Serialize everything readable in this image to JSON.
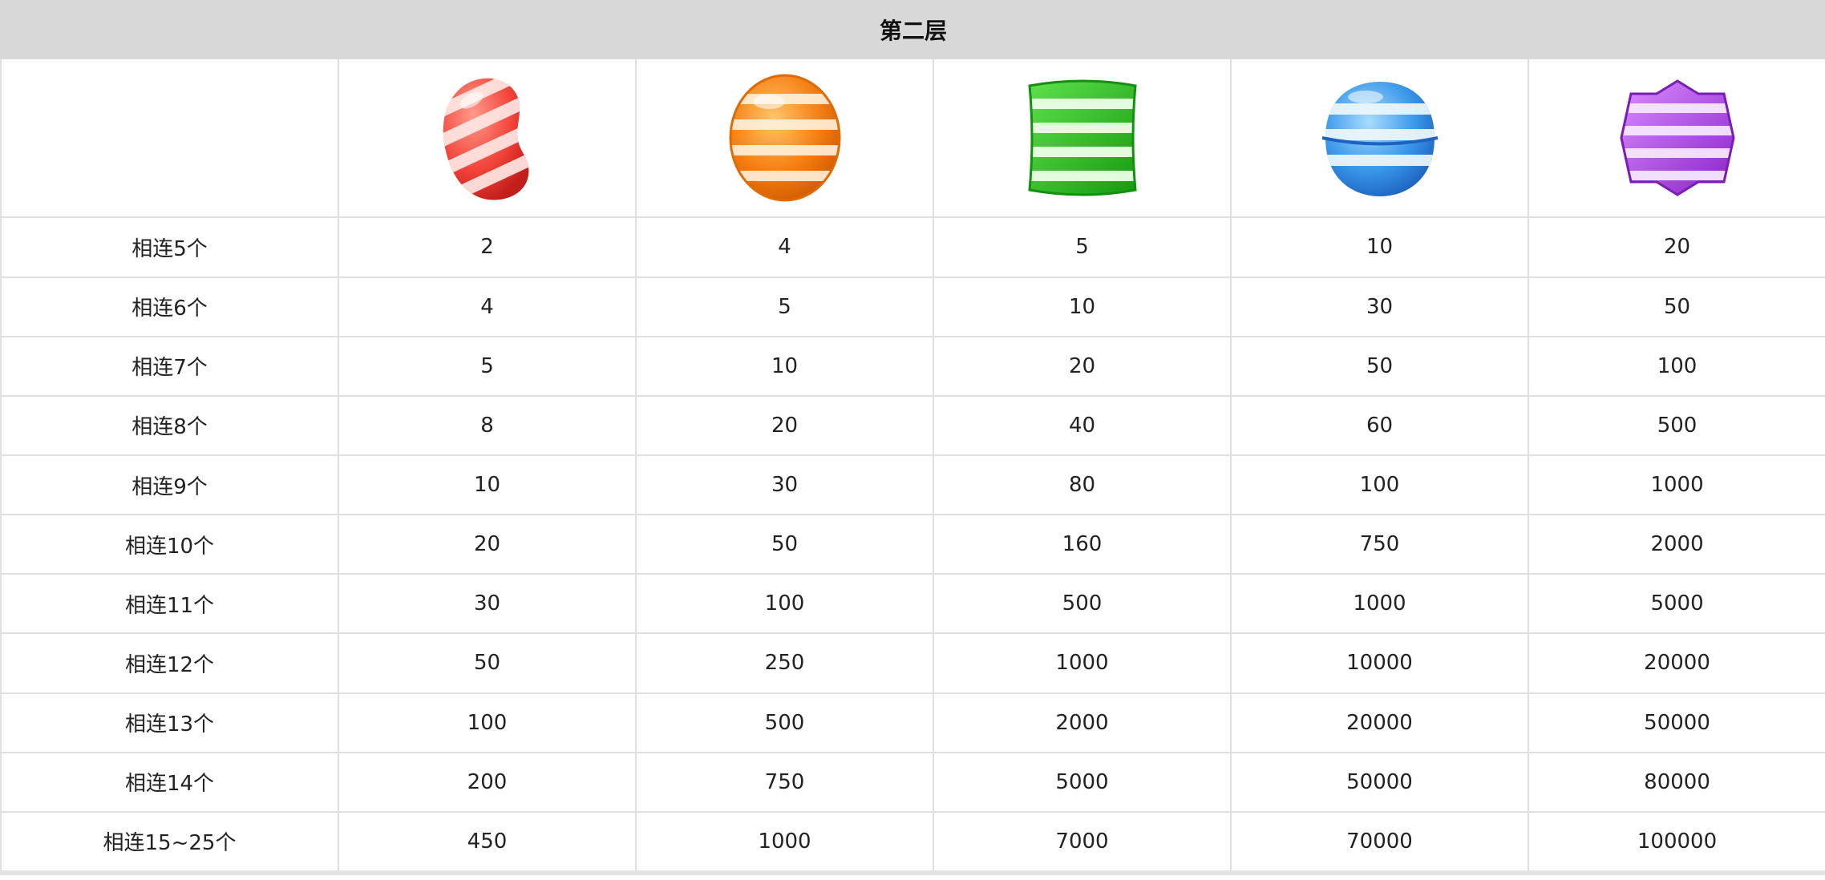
{
  "title": "第二层",
  "symbols": [
    {
      "icon": "red-striped-jellybean-candy-icon",
      "color": "#f04a3c"
    },
    {
      "icon": "orange-striped-round-candy-icon",
      "color": "#f07a12"
    },
    {
      "icon": "green-striped-square-candy-icon",
      "color": "#25b81c"
    },
    {
      "icon": "blue-striped-ball-candy-icon",
      "color": "#2f8fe0"
    },
    {
      "icon": "purple-striped-star-candy-icon",
      "color": "#a43ee0"
    }
  ],
  "rows": [
    {
      "label": "相连5个",
      "values": [
        "2",
        "4",
        "5",
        "10",
        "20"
      ]
    },
    {
      "label": "相连6个",
      "values": [
        "4",
        "5",
        "10",
        "30",
        "50"
      ]
    },
    {
      "label": "相连7个",
      "values": [
        "5",
        "10",
        "20",
        "50",
        "100"
      ]
    },
    {
      "label": "相连8个",
      "values": [
        "8",
        "20",
        "40",
        "60",
        "500"
      ]
    },
    {
      "label": "相连9个",
      "values": [
        "10",
        "30",
        "80",
        "100",
        "1000"
      ]
    },
    {
      "label": "相连10个",
      "values": [
        "20",
        "50",
        "160",
        "750",
        "2000"
      ]
    },
    {
      "label": "相连11个",
      "values": [
        "30",
        "100",
        "500",
        "1000",
        "5000"
      ]
    },
    {
      "label": "相连12个",
      "values": [
        "50",
        "250",
        "1000",
        "10000",
        "20000"
      ]
    },
    {
      "label": "相连13个",
      "values": [
        "100",
        "500",
        "2000",
        "20000",
        "50000"
      ]
    },
    {
      "label": "相连14个",
      "values": [
        "200",
        "750",
        "5000",
        "50000",
        "80000"
      ]
    },
    {
      "label": "相连15~25个",
      "values": [
        "450",
        "1000",
        "7000",
        "70000",
        "100000"
      ]
    }
  ]
}
